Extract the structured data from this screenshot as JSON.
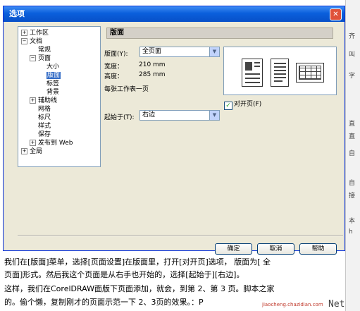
{
  "dialog": {
    "title": "选项",
    "close_glyph": "✕"
  },
  "tree": {
    "items": [
      {
        "toggle": "+",
        "label": "工作区"
      },
      {
        "toggle": "−",
        "label": "文档"
      },
      {
        "toggle": "",
        "label": "常规"
      },
      {
        "toggle": "−",
        "label": "页面"
      },
      {
        "toggle": "",
        "label": "大小"
      },
      {
        "toggle": "",
        "label": "版面"
      },
      {
        "toggle": "",
        "label": "标签"
      },
      {
        "toggle": "",
        "label": "背景"
      },
      {
        "toggle": "+",
        "label": "辅助线"
      },
      {
        "toggle": "",
        "label": "网格"
      },
      {
        "toggle": "",
        "label": "标尺"
      },
      {
        "toggle": "",
        "label": "样式"
      },
      {
        "toggle": "",
        "label": "保存"
      },
      {
        "toggle": "+",
        "label": "发布到 Web"
      },
      {
        "toggle": "+",
        "label": "全局"
      }
    ]
  },
  "panel": {
    "header": "版面",
    "layout_label": "版面(Y):",
    "layout_value": "全页面",
    "width_label": "宽度：",
    "width_value": "210 mm",
    "height_label": "高度：",
    "height_value": "285 mm",
    "per_sheet_text": "每张工作表一页",
    "facing_label": "对开页(F)",
    "facing_check": "✓",
    "start_label": "起始于(T):",
    "start_value": "右边",
    "dropdown_glyph": "▼"
  },
  "buttons": {
    "ok": "确定",
    "cancel": "取消",
    "help": "帮助"
  },
  "right_strip": [
    "齐",
    "叫",
    "字",
    "直",
    "直",
    "自",
    "自",
    "接",
    "本",
    "h"
  ],
  "article": {
    "line1": "我们在[版面]菜单，选择[页面设置]在版面里，打开[对开页]选项， 版面为[ 全",
    "line2": "页面]形式。然后我这个页面是从右手也开始的，选择[起始于][右边]。",
    "line3": "这样，我们在CorelDRAW面版下页面添加，就会，到第 2、第 3 页。脚本之家",
    "line4": "的。偷个懒，复制刚才的页面示范一下 2、3页的效果。：P",
    "watermark": "jiaocheng.chazidian.com",
    "net_text": "Net"
  }
}
